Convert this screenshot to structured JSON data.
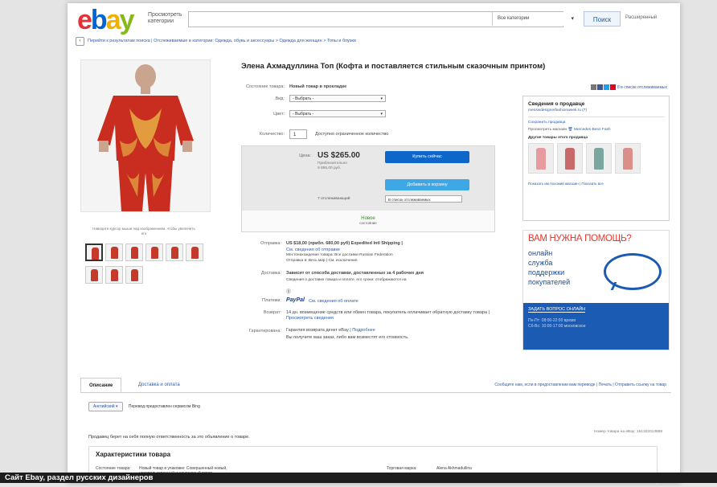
{
  "header": {
    "logo": [
      "e",
      "b",
      "a",
      "y"
    ],
    "shop_by": "Просмотреть категории",
    "category": "Все категории",
    "search_button": "Поиск",
    "advanced": "Расширенный"
  },
  "breadcrumb": "Перейти к результатам поиска | Отслеживаемые в категории: Одежда, обувь и аксессуары > Одежда для женщин > Топы и блузки",
  "product": {
    "title": "Элена Ахмадуллина Топ (Кофта и поставляется стильным сказочным принтом)",
    "image_caption": "Наведите курсор мыши над изображением, чтобы увеличить его",
    "condition_label": "Состояние товара:",
    "condition_value": "Новый товар в прокладке",
    "size_label": "Вид:",
    "size_value": "- Выбрать -",
    "color_label": "Цвет:",
    "color_value": "- Выбрать -",
    "quantity_label": "Количество:",
    "quantity_value": "1",
    "quantity_note": "Доступно ограниченное количество",
    "price_label": "Цена:",
    "price": "US $265.00",
    "price_approx": "Приблизительно",
    "price_rub": "9 895,00 руб.",
    "buy_now": "Купить сейчас",
    "add_to_cart": "Добавить в корзину",
    "watchers": "7 отслеживающий",
    "watch_select": "В список отслеживаемых",
    "new_label": "Новое",
    "condition_small": "состояние"
  },
  "shipping": {
    "ship_label": "Отправка:",
    "ship_value": "US $18,00 (прибл. 680,00 руб) Expedited Intl Shipping |",
    "ship_details": "См. сведения об отправке",
    "ship_location": "Местонахождение товара: Все доставки Russian Federation",
    "ship_to": "Отправка в: Весь мир | См. исключения",
    "delivery_label": "Доставка:",
    "delivery_value": "Зависит от способа доставки, доставленных за 4 рабочих дня",
    "delivery_note": "Сведения о доставке товара и оплате, его сроки: отображаются на",
    "payment_label": "Платежи:",
    "payment_value": "PayPal",
    "payment_link": "См. сведения об оплате",
    "returns_label": "Возврат:",
    "returns_value": "14 дн. возмещение средств или обмен товара, покупатель оплачивает обратную доставку товара |",
    "returns_link": "Просмотреть сведения",
    "guarantee_label": "Гарантирована:",
    "guarantee_value": "Гарантия возврата денег eBay |",
    "guarantee_link": "Подробнее",
    "guarantee_note": "Вы получите ваш заказ, либо вам возместят его стоимость."
  },
  "share": {
    "link": "8 в списке отслеживаемых",
    "colors": [
      "#777777",
      "#3b5998",
      "#1da1f2",
      "#e60023"
    ]
  },
  "seller": {
    "title": "Сведения о продавце",
    "name": "menswdesignerfashionweek.ru (7)",
    "save_seller": "Сохранить продавца",
    "view_label": "Просмотреть магазин",
    "store_name": "Mercedes-Benz Fash",
    "other_items": "Другие товары этого продавца",
    "footer": "Показать им похожий магазин | Показать все",
    "thumb_colors": [
      "#e79aa0",
      "#c96a6a",
      "#7aa6a0",
      "#d9908a"
    ]
  },
  "help": {
    "title": "ВАМ НУЖНА ПОМОЩЬ?",
    "lines": [
      "онлайн",
      "служба",
      "поддержки",
      "покупателей"
    ],
    "button": "ЗАДАТЬ ВОПРОС ОНЛАЙН",
    "hours1": "Пн-Пт: 08:00-22:00 время",
    "hours2": "Сб-Вс: 10:00-17:00 московское"
  },
  "tabs": {
    "description": "Описание",
    "shipping": "Доставка и оплата",
    "links": "Сообщите нам, если в предоставлении вам переводе | Печать | Отправить ссылку на товар"
  },
  "translate": {
    "button": "Английский ▾",
    "note": "Перевод предоставлен сервисом Bing"
  },
  "description": {
    "responsibility": "Продавец берет на себя полную ответственность за это объявление о товаре.",
    "item_number": "Номер товара на eBay: 151322013888",
    "specs_title": "Характеристики товара",
    "spec_condition_label": "Состояние товара:",
    "spec_condition_value": "Новый товар в упаковке: Совершенный новый, неиспользованный и неношеный товар",
    "spec_brand_label": "Торговая марка:",
    "spec_brand_value": "Alena Akhmadullina"
  },
  "caption": "Сайт Ebay, раздел русских дизайнеров"
}
